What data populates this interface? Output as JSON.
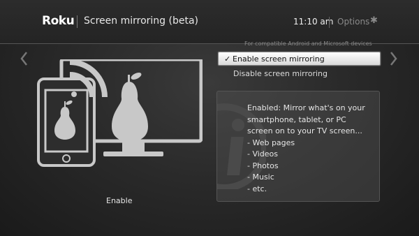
{
  "header": {
    "logo": "Roku",
    "title": "Screen mirroring (beta)",
    "time": "11:10  am",
    "options": "Options",
    "options_icon": "star-icon"
  },
  "compat_note": "For compatible Android and Microsoft devices",
  "menu": {
    "items": [
      {
        "label": "Enable screen mirroring",
        "selected": true,
        "checked": true
      },
      {
        "label": "Disable screen mirroring",
        "selected": false,
        "checked": false
      }
    ]
  },
  "info": {
    "lines": [
      "Enabled: Mirror what's on your",
      "smartphone, tablet, or PC",
      "screen on to your TV screen...",
      "- Web pages",
      "- Videos",
      "- Photos",
      "- Music",
      "- etc."
    ]
  },
  "illustration_caption": "Enable",
  "colors": {
    "background": "#2a2a2a",
    "device_outline": "#c8c8c8",
    "selected_bg": "#f0f0f0"
  }
}
